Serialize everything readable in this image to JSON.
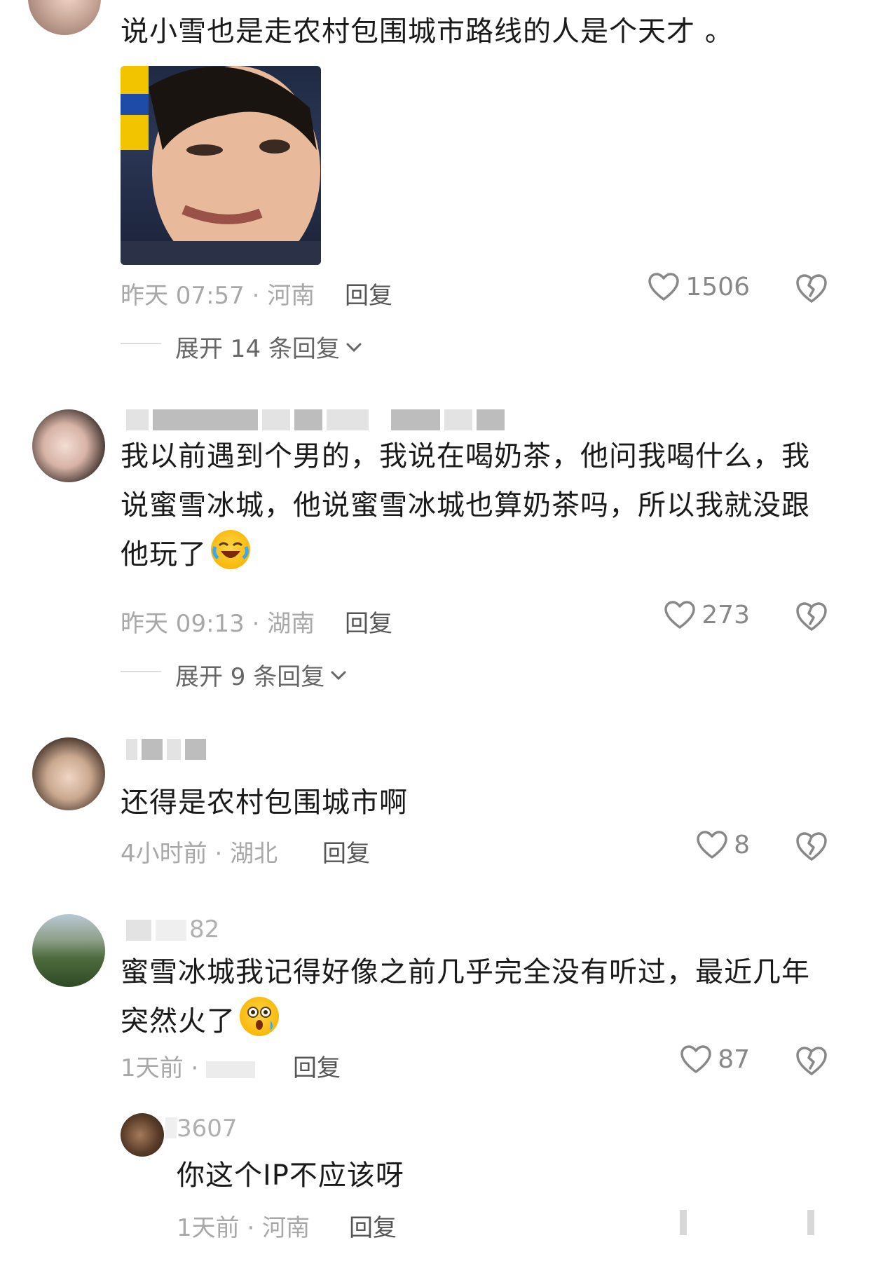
{
  "comments": [
    {
      "text": "说小雪也是走农村包围城市路线的人是个天才 。",
      "time": "昨天 07:57",
      "location": "河南",
      "reply_label": "回复",
      "likes": "1506",
      "expand_label": "展开 14 条回复"
    },
    {
      "name_tail": "",
      "text": "我以前遇到个男的，我说在喝奶茶，他问我喝什么，我说蜜雪冰城，他说蜜雪冰城也算奶茶吗，所以我就没跟他玩了",
      "time": "昨天 09:13",
      "location": "湖南",
      "reply_label": "回复",
      "likes": "273",
      "expand_label": "展开 9 条回复"
    },
    {
      "text": "还得是农村包围城市啊",
      "time": "4小时前",
      "location": "湖北",
      "reply_label": "回复",
      "likes": "8"
    },
    {
      "name_tail": "82",
      "text": "蜜雪冰城我记得好像之前几乎完全没有听过，最近几年突然火了",
      "time": "1天前",
      "location": "",
      "reply_label": "回复",
      "likes": "87"
    }
  ],
  "reply": {
    "name_tail": "3607",
    "text": "你这个IP不应该呀",
    "time": "1天前",
    "location": "河南",
    "reply_label": "回复"
  },
  "separator": " · ",
  "icons": {
    "like": "heart-outline-icon",
    "dislike": "broken-heart-icon",
    "expand": "chevron-down-icon",
    "reply_emoji": "crying-laughing-emoji",
    "surprised_emoji": "surprised-emoji"
  }
}
